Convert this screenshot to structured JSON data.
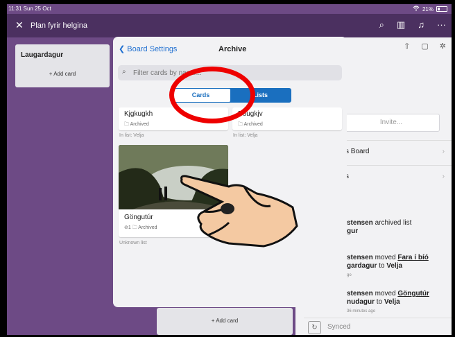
{
  "status": {
    "time": "11:31 Sun 25 Oct",
    "battery": "21%"
  },
  "topbar": {
    "title": "Plan fyrir helgina"
  },
  "board": {
    "list1_title": "Laugardagur",
    "add_card": "+ Add card",
    "add_card_2": "+ Add card"
  },
  "sidebar": {
    "invite": "Invite...",
    "row1": "s Board",
    "row2": "s",
    "act1_user": "stensen",
    "act1_text": " archived list",
    "act1_obj": "gur",
    "act2_user": "stensen",
    "act2_text": " moved ",
    "act2_link": "Fara í bíó",
    "act2_line2a": "gardagur",
    "act2_line2b": " to ",
    "act2_target": "Velja",
    "act2_ago": "go",
    "act3_user": "stensen",
    "act3_text": " moved ",
    "act3_link": "Göngutúr",
    "act3_line2a": "nudagur",
    "act3_line2b": " to ",
    "act3_target": "Velja",
    "act3_ago": "36 minutes ago",
    "synced": "Synced"
  },
  "modal": {
    "back": "Board Settings",
    "title": "Archive",
    "filter_placeholder": "Filter cards by name...",
    "tab_cards": "Cards",
    "tab_lists": "Lists",
    "cards": [
      {
        "name": "Kjgkugkh",
        "archived": "Archived",
        "list": "In list: Velja"
      },
      {
        "name": "Bougkjv",
        "archived": "Archived",
        "list": "In list: Velja"
      },
      {
        "name": "Göngutúr",
        "meta": "1",
        "archived": "Archived",
        "list": "Unknown list"
      }
    ]
  },
  "colors": {
    "accent": "#1a6fbf",
    "board_bg": "#6d4a85",
    "annotation": "#e00000"
  }
}
